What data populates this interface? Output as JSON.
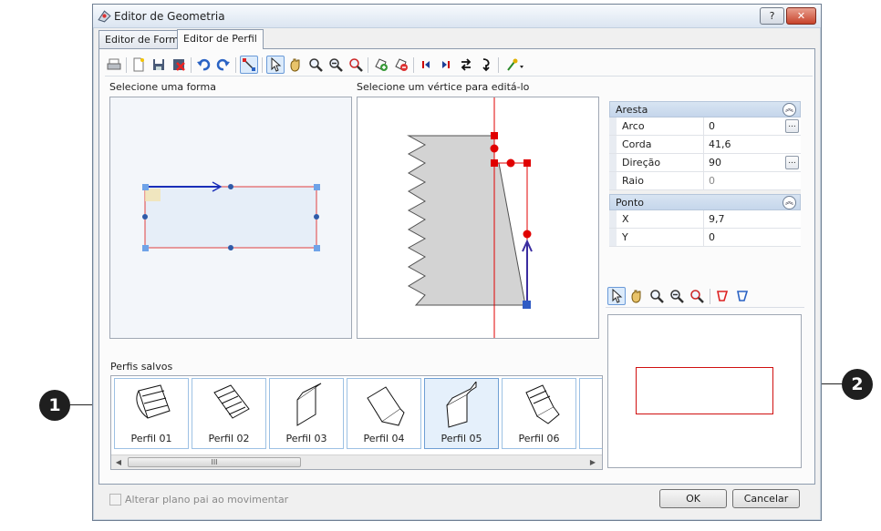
{
  "window": {
    "title": "Editor de Geometria",
    "help_label": "?",
    "close_label": "✕"
  },
  "tabs": [
    {
      "label": "Editor de Forma"
    },
    {
      "label": "Editor de Perfil"
    }
  ],
  "left": {
    "caption": "Selecione uma forma"
  },
  "middle": {
    "caption": "Selecione um vértice para editá-lo"
  },
  "aresta": {
    "title": "Aresta",
    "rows": [
      {
        "name": "Arco",
        "value": "0"
      },
      {
        "name": "Corda",
        "value": "41,6"
      },
      {
        "name": "Direção",
        "value": "90"
      },
      {
        "name": "Raio",
        "value": "0"
      }
    ]
  },
  "ponto": {
    "title": "Ponto",
    "rows": [
      {
        "name": "X",
        "value": "9,7"
      },
      {
        "name": "Y",
        "value": "0"
      }
    ]
  },
  "profiles": {
    "caption": "Perfis salvos",
    "items": [
      "Perfil 01",
      "Perfil 02",
      "Perfil 03",
      "Perfil 04",
      "Perfil 05",
      "Perfil 06"
    ],
    "selected": "Perfil 05",
    "scroll_thumb": "III"
  },
  "footer": {
    "checkbox_label": "Alterar plano pai ao movimentar",
    "ok_label": "OK",
    "cancel_label": "Cancelar"
  },
  "callouts": [
    "1",
    "2"
  ],
  "toolbar_icons": [
    "print-icon",
    "new-icon",
    "save-icon",
    "delete-icon",
    "undo-icon",
    "redo-icon",
    "edit-points-icon",
    "select-icon",
    "pan-icon",
    "zoom-icon",
    "zoom-out-icon",
    "zoom-fit-icon",
    "add-vertex-icon",
    "remove-vertex-icon",
    "first-icon",
    "last-icon",
    "reverse-icon",
    "mirror-icon",
    "dxf-import-icon"
  ],
  "colors": {
    "accent": "#3b7fd6",
    "shape_red": "#e00000",
    "shape_blue": "#3060c0"
  }
}
